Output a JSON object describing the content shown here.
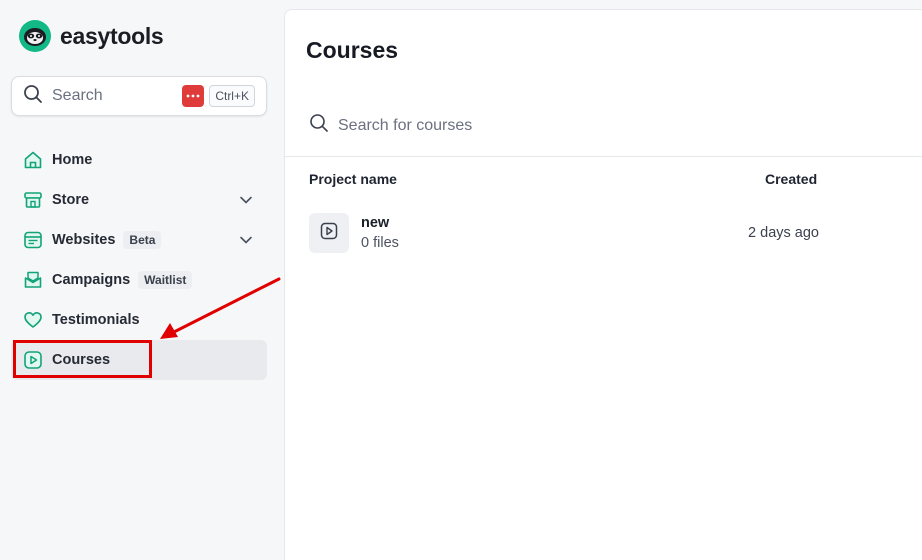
{
  "app": {
    "name": "easytools"
  },
  "colors": {
    "brand": "#12b886",
    "highlight": "#e00000",
    "active_bg": "#e9eaed"
  },
  "sidebar": {
    "search": {
      "label": "Search",
      "shortcut": "Ctrl+K"
    },
    "items": [
      {
        "label": "Home",
        "icon": "home-icon"
      },
      {
        "label": "Store",
        "icon": "store-icon",
        "expandable": true
      },
      {
        "label": "Websites",
        "icon": "website-icon",
        "badge": "Beta",
        "expandable": true
      },
      {
        "label": "Campaigns",
        "icon": "mail-icon",
        "badge": "Waitlist"
      },
      {
        "label": "Testimonials",
        "icon": "heart-icon"
      },
      {
        "label": "Courses",
        "icon": "play-icon",
        "active": true
      }
    ]
  },
  "main": {
    "title": "Courses",
    "search_placeholder": "Search for courses",
    "columns": {
      "name": "Project name",
      "created": "Created"
    },
    "rows": [
      {
        "name": "new",
        "files": "0 files",
        "created": "2 days ago",
        "icon": "play-icon"
      }
    ]
  }
}
